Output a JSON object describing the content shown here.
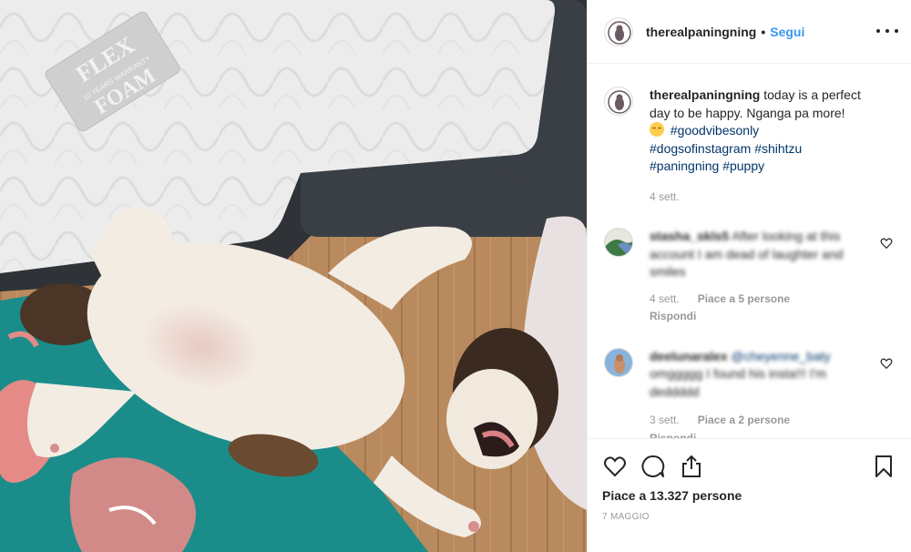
{
  "header": {
    "username": "therealpaningning",
    "separator": "•",
    "follow_label": "Segui",
    "more_icon": "more-horizontal-icon"
  },
  "caption": {
    "username": "therealpaningning",
    "text": "today is a perfect day to be happy. Nganga pa more!",
    "emoji": "relieved-face-emoji",
    "hashtags": [
      "#goodvibesonly",
      "#dogsofinstagram",
      "#shihtzu",
      "#paningning",
      "#puppy"
    ],
    "time": "4 sett."
  },
  "comments": [
    {
      "username": "stasha_skls5",
      "text": "After looking at this account I am dead of laughter and smiles",
      "time": "4 sett.",
      "likes": "Piace a 5 persone",
      "reply": "Rispondi"
    },
    {
      "username": "deelunaralex",
      "mention": "@cheyenne_baty",
      "text": "omggggg I found his insta!!! I'm deddddd",
      "time": "3 sett.",
      "likes": "Piace a 2 persone",
      "reply": "Rispondi"
    }
  ],
  "actions": {
    "like_icon": "heart-icon",
    "comment_icon": "comment-icon",
    "share_icon": "share-icon",
    "save_icon": "bookmark-icon",
    "likes_count": "Piace a 13.327 persone",
    "date": "7 maggio"
  },
  "photo": {
    "mattress_label_line1": "FLEX",
    "mattress_label_line2": "FOAM",
    "mattress_label_small": "10 YEARS WARRANTY",
    "colors": {
      "mattress": "#ececec",
      "bed_frame": "#33373c",
      "floor": "#b88b5f",
      "blanket": "#1b8d8b",
      "flamingo": "#e58a86",
      "fur": "#f3ece2"
    }
  },
  "colors": {
    "link_blue": "#3897f0",
    "hashtag_blue": "#003569",
    "text": "#262626",
    "muted": "#999999",
    "border": "#efefef"
  }
}
